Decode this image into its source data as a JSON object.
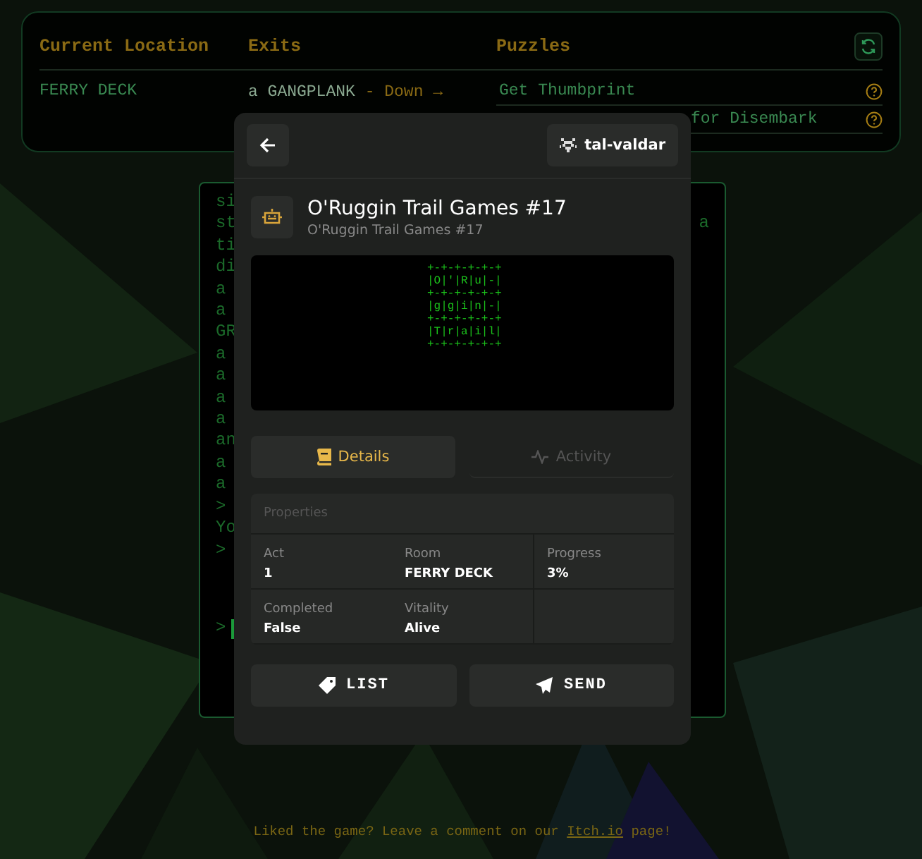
{
  "status_panel": {
    "columns": [
      "Current Location",
      "Exits",
      "Puzzles"
    ],
    "location": "FERRY DECK",
    "exits": [
      {
        "name": "a GANGPLANK",
        "sep": " - ",
        "direction": "Down",
        "arrow": "→"
      }
    ],
    "puzzles": [
      {
        "text": "Get Thumbprint",
        "covered_left": false
      },
      {
        "text": "for Disembark",
        "covered_left": true
      }
    ]
  },
  "terminal": {
    "lines": [
      {
        "left": "si"
      },
      {
        "left": "st",
        "right": "a"
      },
      {
        "left": "ti"
      },
      {
        "left": "di"
      },
      {
        "left": "a"
      },
      {
        "left": "a"
      },
      {
        "left": "GR"
      },
      {
        "left": "a"
      },
      {
        "left": "a"
      },
      {
        "left": "a"
      },
      {
        "left": "a"
      },
      {
        "left": "an"
      },
      {
        "left": "a"
      },
      {
        "left": "a"
      },
      {
        "left": ">"
      },
      {
        "left": "Yo"
      },
      {
        "left": ">"
      }
    ],
    "prompt": ">"
  },
  "modal": {
    "user": "tal-valdar",
    "title": "O'Ruggin Trail Games #17",
    "subtitle": "O'Ruggin Trail Games #17",
    "art": [
      "+-+-+-+-+-+",
      "|O|'|R|u|-|",
      "+-+-+-+-+-+",
      "|g|g|i|n|-|",
      "+-+-+-+-+-+",
      "|T|r|a|i|l|",
      "+-+-+-+-+-+"
    ],
    "tabs": [
      {
        "label": "Details",
        "selected": true
      },
      {
        "label": "Activity",
        "selected": false
      }
    ],
    "properties": {
      "title": "Properties",
      "items": [
        {
          "label": "Act",
          "value": "1"
        },
        {
          "label": "Room",
          "value": "FERRY DECK"
        },
        {
          "label": "Progress",
          "value": "3%"
        },
        {
          "label": "Completed",
          "value": "False"
        },
        {
          "label": "Vitality",
          "value": "Alive"
        }
      ]
    },
    "buttons": [
      {
        "kind": "tag",
        "label": "LIST"
      },
      {
        "kind": "send",
        "label": "SEND"
      }
    ]
  },
  "footer": {
    "before": "Liked the game? Leave a comment on our ",
    "link": "Itch.io",
    "after": " page!"
  }
}
